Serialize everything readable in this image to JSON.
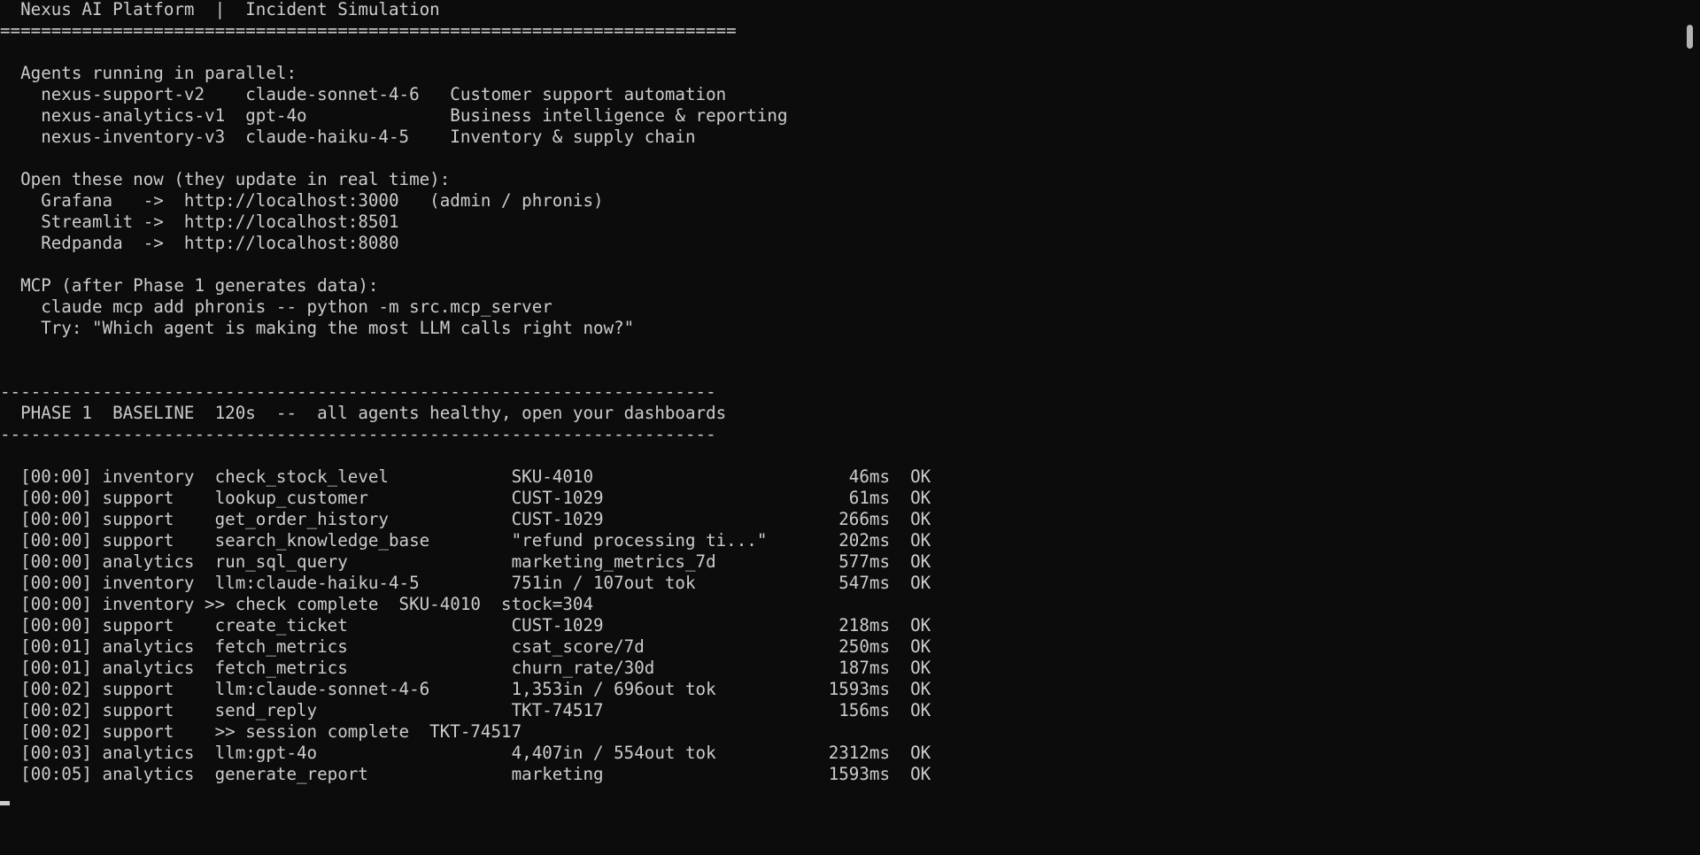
{
  "terminal": {
    "lines": [
      "  Nexus AI Platform  |  Incident Simulation",
      "========================================================================",
      "",
      "  Agents running in parallel:",
      "    nexus-support-v2    claude-sonnet-4-6   Customer support automation",
      "    nexus-analytics-v1  gpt-4o              Business intelligence & reporting",
      "    nexus-inventory-v3  claude-haiku-4-5    Inventory & supply chain",
      "",
      "  Open these now (they update in real time):",
      "    Grafana   ->  http://localhost:3000   (admin / phronis)",
      "    Streamlit ->  http://localhost:8501",
      "    Redpanda  ->  http://localhost:8080",
      "",
      "  MCP (after Phase 1 generates data):",
      "    claude mcp add phronis -- python -m src.mcp_server",
      "    Try: \"Which agent is making the most LLM calls right now?\"",
      "",
      "",
      "----------------------------------------------------------------------",
      "  PHASE 1  BASELINE  120s  --  all agents healthy, open your dashboards",
      "----------------------------------------------------------------------",
      "",
      "  [00:00] inventory  check_stock_level            SKU-4010                         46ms  OK",
      "  [00:00] support    lookup_customer              CUST-1029                        61ms  OK",
      "  [00:00] support    get_order_history            CUST-1029                       266ms  OK",
      "  [00:00] support    search_knowledge_base        \"refund processing ti...\"       202ms  OK",
      "  [00:00] analytics  run_sql_query                marketing_metrics_7d            577ms  OK",
      "  [00:00] inventory  llm:claude-haiku-4-5         751in / 107out tok              547ms  OK",
      "  [00:00] inventory >> check complete  SKU-4010  stock=304",
      "  [00:00] support    create_ticket                CUST-1029                       218ms  OK",
      "  [00:01] analytics  fetch_metrics                csat_score/7d                   250ms  OK",
      "  [00:01] analytics  fetch_metrics                churn_rate/30d                  187ms  OK",
      "  [00:02] support    llm:claude-sonnet-4-6        1,353in / 696out tok           1593ms  OK",
      "  [00:02] support    send_reply                   TKT-74517                       156ms  OK",
      "  [00:02] support    >> session complete  TKT-74517",
      "  [00:03] analytics  llm:gpt-4o                   4,407in / 554out tok           2312ms  OK",
      "  [00:05] analytics  generate_report              marketing                      1593ms  OK"
    ]
  },
  "colors": {
    "background": "#0c0c0c",
    "text": "#cccccc",
    "scrollbar_thumb": "#b3b3b3"
  }
}
